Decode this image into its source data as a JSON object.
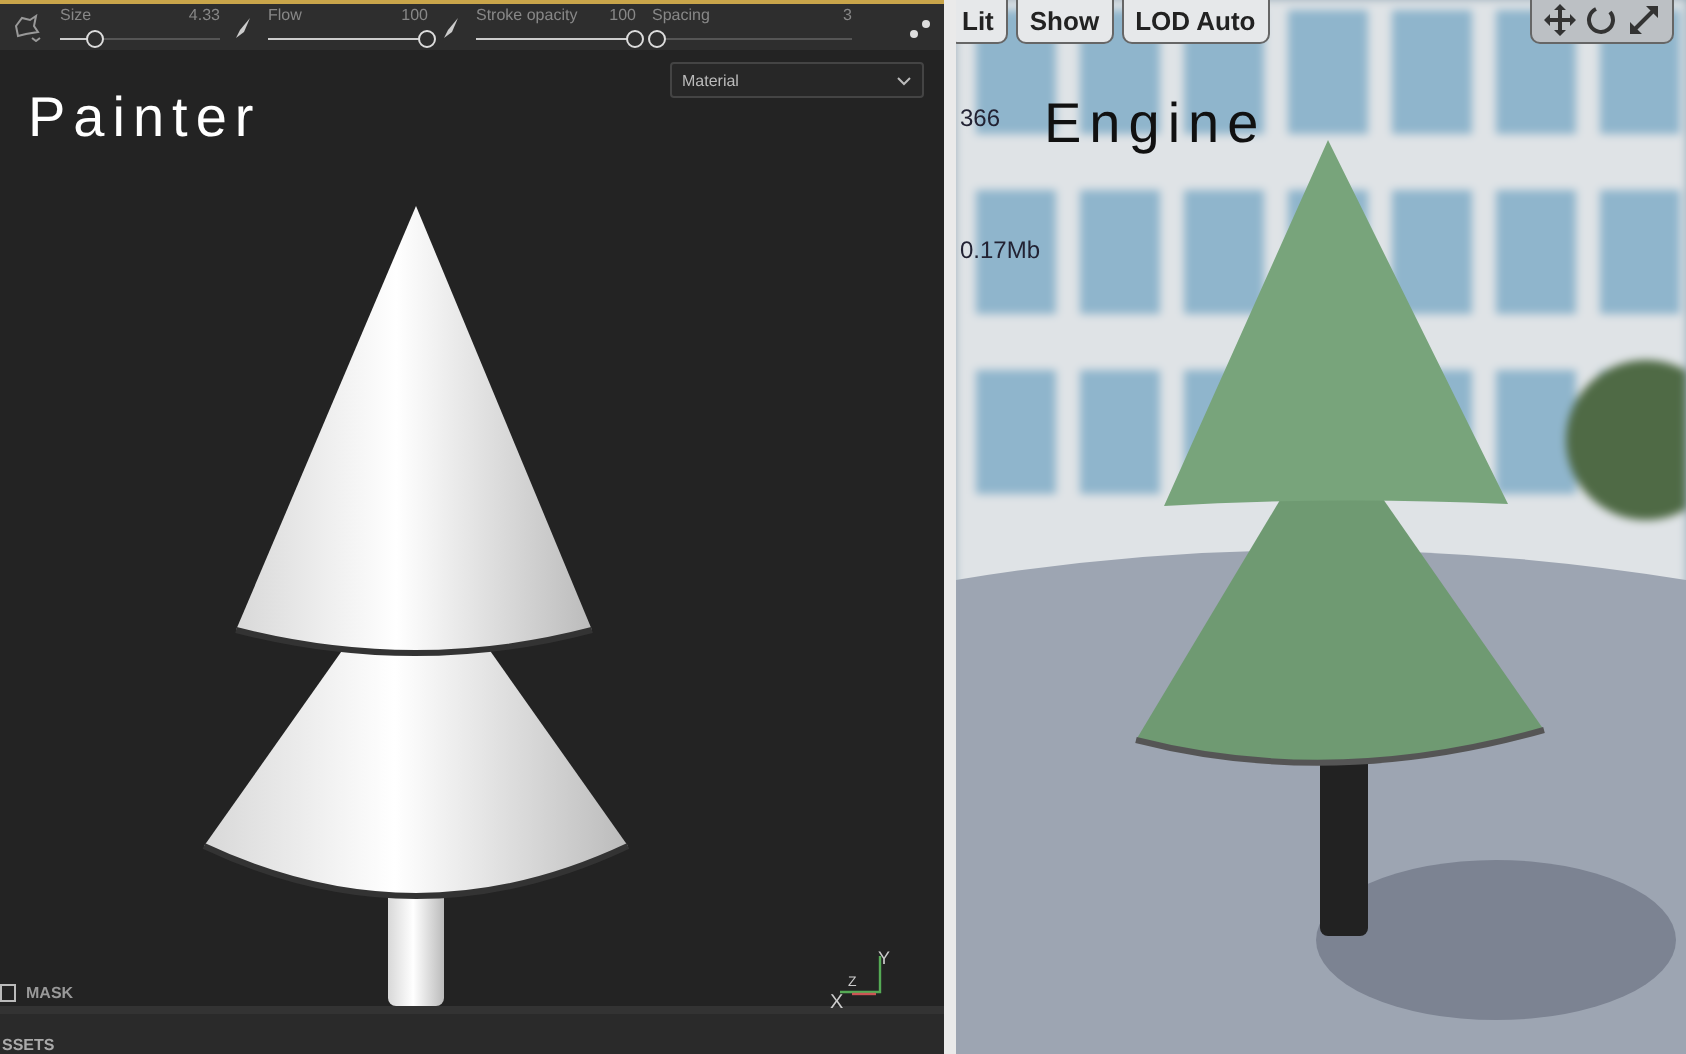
{
  "painter": {
    "toolbar": {
      "sliders": [
        {
          "label": "Size",
          "reading": "4.33",
          "level": 0.22
        },
        {
          "label": "Flow",
          "reading": "100",
          "level": 1
        },
        {
          "label": "Stroke opacity",
          "reading": "100",
          "level": 1
        },
        {
          "label": "Spacing",
          "reading": "3",
          "level": 0.03
        }
      ]
    },
    "title": "Painter",
    "dropdown": {
      "value": "Material"
    },
    "axes": [
      "X",
      "Z",
      "Y"
    ],
    "mask": {
      "label": "MASK",
      "checked": false
    },
    "bottom_panel": {
      "label": "SSETS"
    }
  },
  "engine": {
    "buttons": [
      "Lit",
      "Show",
      "LOD Auto"
    ],
    "title": "Engine",
    "stats": [
      "366",
      "0.17Mb"
    ]
  }
}
